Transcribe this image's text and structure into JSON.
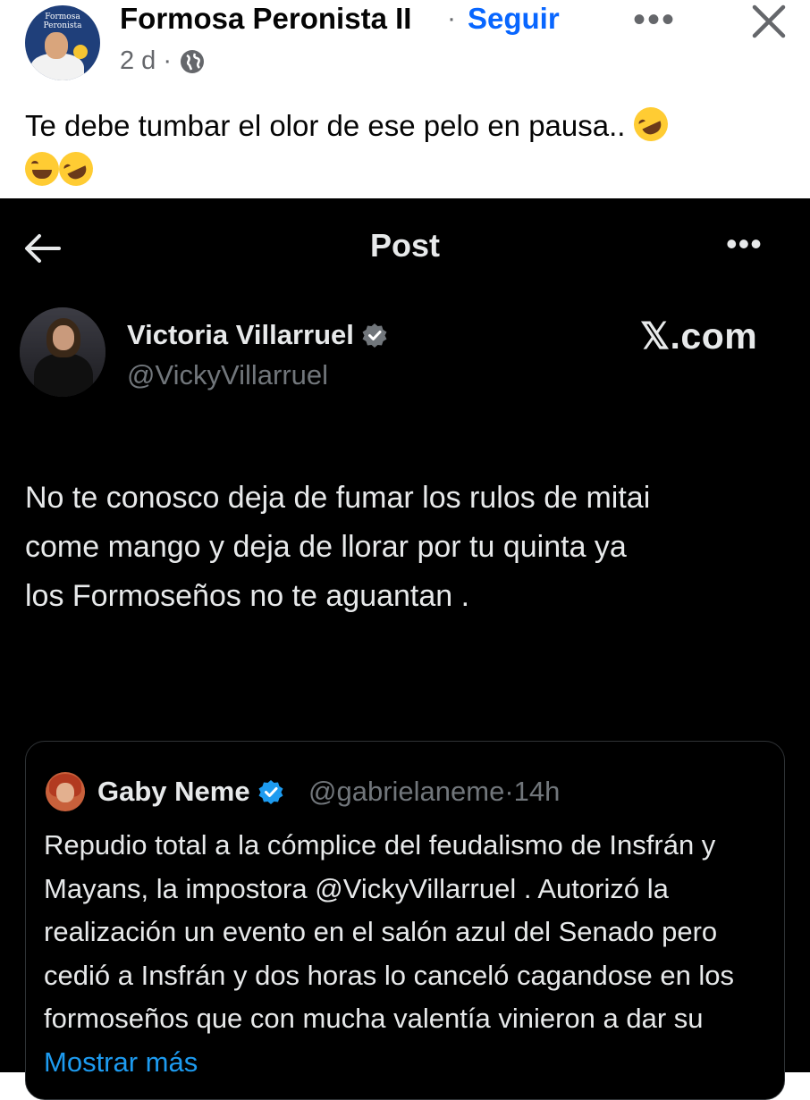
{
  "fb_post": {
    "author": "Formosa Peronista II",
    "separator": "·",
    "follow_label": "Seguir",
    "more_label": "•••",
    "time": "2 d",
    "time_separator": "·",
    "avatar_text": "Formosa Peronista",
    "caption": "Te debe tumbar el olor de ese pelo en pausa..",
    "caption_emojis": [
      "rolling-on-floor-laughing",
      "face-with-tears-of-joy",
      "rolling-on-floor-laughing"
    ]
  },
  "x_post": {
    "header_title": "Post",
    "more_label": "•••",
    "author_name": "Victoria Villarruel",
    "author_handle": "@VickyVillarruel",
    "watermark": "𝕏.com",
    "text": "No te conosco deja de fumar los rulos de mitai\ncome mango y deja de llorar por tu quinta ya\nlos Formoseños no te aguantan .",
    "quote": {
      "author_name": "Gaby Neme",
      "handle_time": "@gabrielaneme·14h",
      "text": "Repudio total a la cómplice del feudalismo de Insfrán y Mayans, la impostora @VickyVillarruel . Autorizó la realización un evento en el salón azul del Senado pero cedió a Insfrán y dos horas lo canceló cagandose en los formoseños que con mucha valentía vinieron a dar su",
      "show_more": "Mostrar más"
    }
  },
  "colors": {
    "fb_blue": "#0866ff",
    "fb_secondary": "#65676b",
    "x_background": "#000000",
    "x_text": "#e7e9ea",
    "x_secondary": "#71767b",
    "x_link": "#1d9bf0",
    "verified_blue": "#1d9bf0"
  }
}
